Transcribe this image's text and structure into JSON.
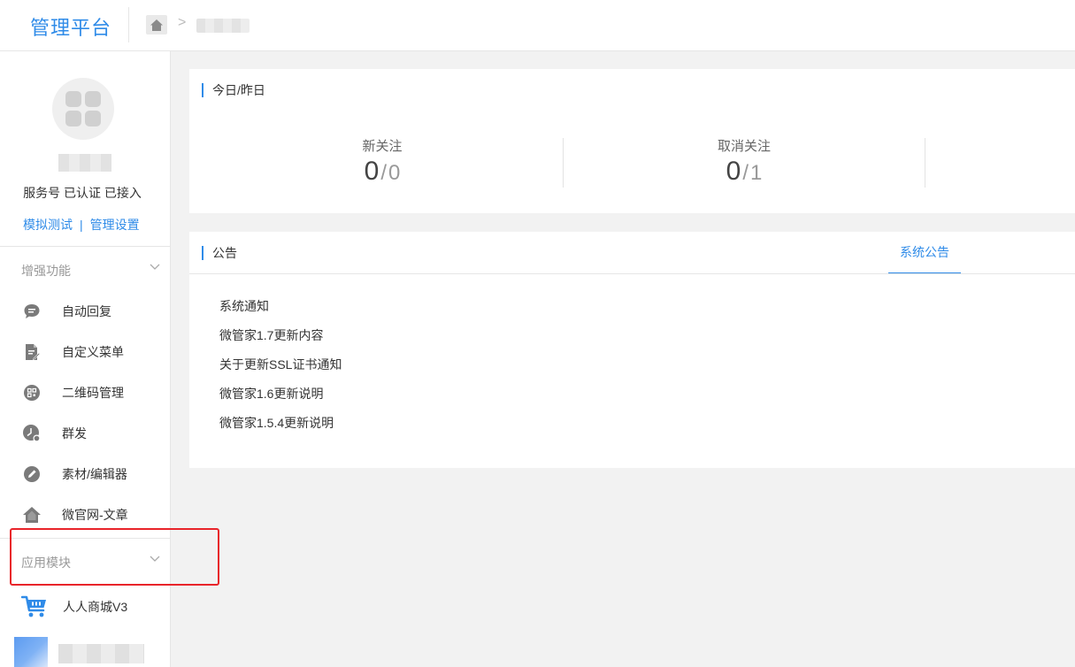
{
  "header": {
    "brand": "管理平台",
    "home_icon": "home-icon",
    "breadcrumb_separator": ">"
  },
  "sidebar": {
    "account_status": "服务号 已认证 已接入",
    "links": [
      "模拟测试",
      "管理设置"
    ],
    "link_separator": "|",
    "groups": [
      {
        "title": "增强功能",
        "items": [
          {
            "label": "自动回复",
            "icon": "chat-bubble-icon"
          },
          {
            "label": "自定义菜单",
            "icon": "document-edit-icon"
          },
          {
            "label": "二维码管理",
            "icon": "qrcode-icon"
          },
          {
            "label": "群发",
            "icon": "clock-broadcast-icon"
          },
          {
            "label": "素材/编辑器",
            "icon": "pencil-icon"
          },
          {
            "label": "微官网-文章",
            "icon": "home-icon"
          }
        ]
      },
      {
        "title": "应用模块",
        "items": [
          {
            "label": "人人商城V3",
            "icon": "shopping-cart-icon"
          }
        ]
      }
    ]
  },
  "stats": {
    "title": "今日/昨日",
    "items": [
      {
        "label": "新关注",
        "today": "0",
        "yesterday": "0"
      },
      {
        "label": "取消关注",
        "today": "0",
        "yesterday": "1"
      }
    ],
    "slash": "/"
  },
  "notices": {
    "title": "公告",
    "tab": "系统公告",
    "items": [
      "系统通知",
      "微管家1.7更新内容",
      "关于更新SSL证书通知",
      "微管家1.6更新说明",
      "微管家1.5.4更新说明"
    ]
  },
  "colors": {
    "accent": "#2f8be8",
    "highlight": "#e8242a",
    "icon_gray": "#7a7a7a"
  }
}
